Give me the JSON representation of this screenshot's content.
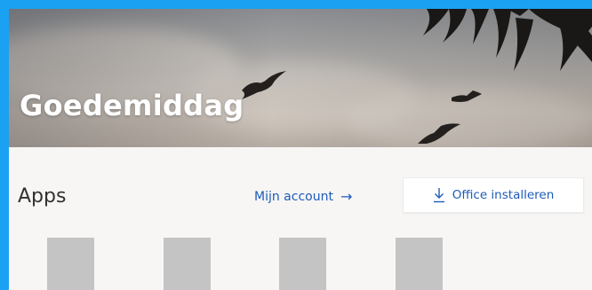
{
  "colors": {
    "frame_border": "#1ba1f2",
    "page_background": "#f7f6f5",
    "link_blue": "#1e5bb8",
    "tile_placeholder": "#c4c4c4"
  },
  "hero": {
    "greeting": "Goedemiddag"
  },
  "apps": {
    "heading": "Apps",
    "account_link_label": "Mijn account",
    "account_link_icon": "arrow-right-icon",
    "install_button_label": "Office installeren",
    "install_button_icon": "download-icon",
    "tiles": [
      {
        "name": "app-tile-1"
      },
      {
        "name": "app-tile-2"
      },
      {
        "name": "app-tile-3"
      },
      {
        "name": "app-tile-4"
      }
    ]
  }
}
